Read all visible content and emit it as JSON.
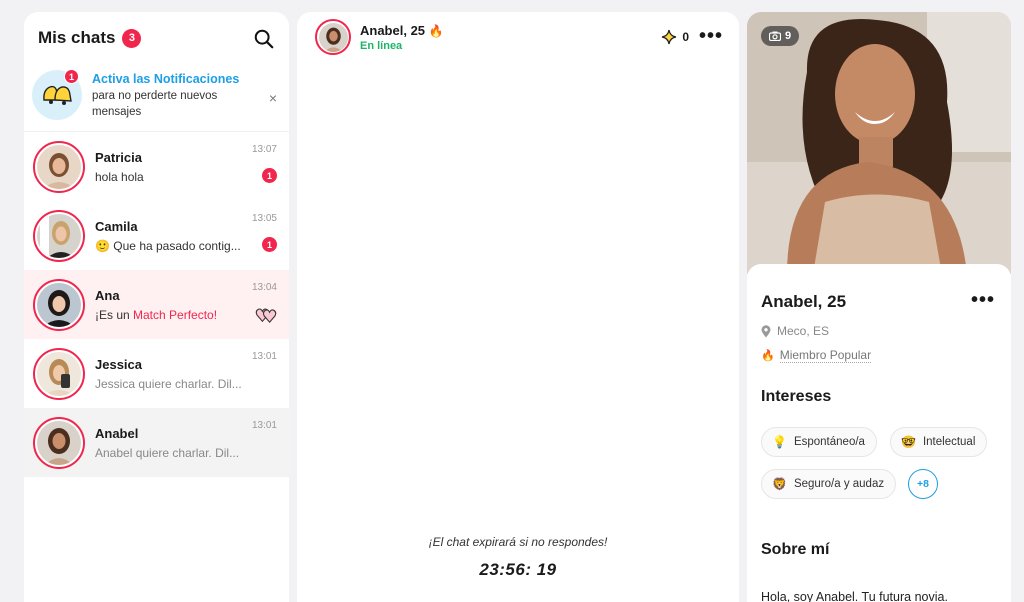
{
  "chats_panel": {
    "title": "Mis chats",
    "unread_total": "3",
    "notification": {
      "badge": "1",
      "title": "Activa las Notificaciones",
      "body": "para no perderte nuevos mensajes",
      "close": "×"
    },
    "chats": [
      {
        "name": "Patricia",
        "preview": "hola hola",
        "time": "13:07",
        "unread": "1"
      },
      {
        "name": "Camila",
        "preview": "Que ha pasado contig...",
        "time": "13:05",
        "unread": "1"
      },
      {
        "name": "Ana",
        "preview_prefix": "¡Es un ",
        "preview_highlight": "Match Perfecto!",
        "time": "13:04"
      },
      {
        "name": "Jessica",
        "preview": "Jessica quiere charlar. Dil...",
        "time": "13:01"
      },
      {
        "name": "Anabel",
        "preview": "Anabel quiere charlar. Dil...",
        "time": "13:01"
      }
    ]
  },
  "conversation": {
    "name": "Anabel, 25",
    "status": "En línea",
    "sparkles": "0",
    "more": "•••",
    "expire_notice": "¡El chat expirará si no respondes!",
    "countdown": "23:56: 19"
  },
  "profile": {
    "photo_count": "9",
    "name": "Anabel, 25",
    "more": "•••",
    "location": "Meco, ES",
    "badge": "Miembro Popular",
    "interests_title": "Intereses",
    "interests": [
      "Espontáneo/a",
      "Intelectual",
      "Seguro/a y audaz"
    ],
    "interests_more": "+8",
    "about_title": "Sobre mí",
    "about": "Hola, soy Anabel. Tu futura novia."
  },
  "colors": {
    "accent": "#f0264d",
    "link_blue": "#1e9ee6",
    "online_green": "#1fb36a",
    "highlight_row": "#fff0f2"
  }
}
